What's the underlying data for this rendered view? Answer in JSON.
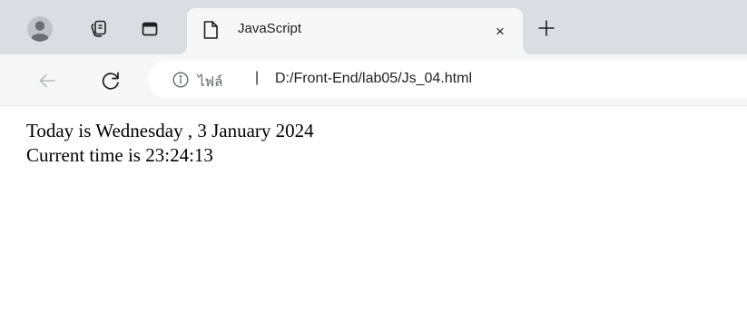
{
  "tabstrip": {
    "icons": {
      "profile": "profile-avatar-icon",
      "workspaces": "workspaces-icon",
      "tab_actions": "tab-actions-icon",
      "new_tab": "plus-icon"
    }
  },
  "tab": {
    "title": "JavaScript",
    "favicon": "page-icon",
    "close_label": "×"
  },
  "toolbar": {
    "site_label": "ไฟล์",
    "divider": "|",
    "url": "D:/Front-End/lab05/Js_04.html",
    "icons": {
      "back": "back-arrow-icon",
      "reload": "reload-icon",
      "site_info": "info-icon"
    }
  },
  "page": {
    "line1": "Today is Wednesday , 3 January 2024",
    "line2": "Current time is 23:24:13"
  },
  "colors": {
    "tabstrip_bg": "#dadde1",
    "active_tab_bg": "#f7f7f7",
    "text": "#1f1f1f",
    "muted": "#5f6368"
  }
}
